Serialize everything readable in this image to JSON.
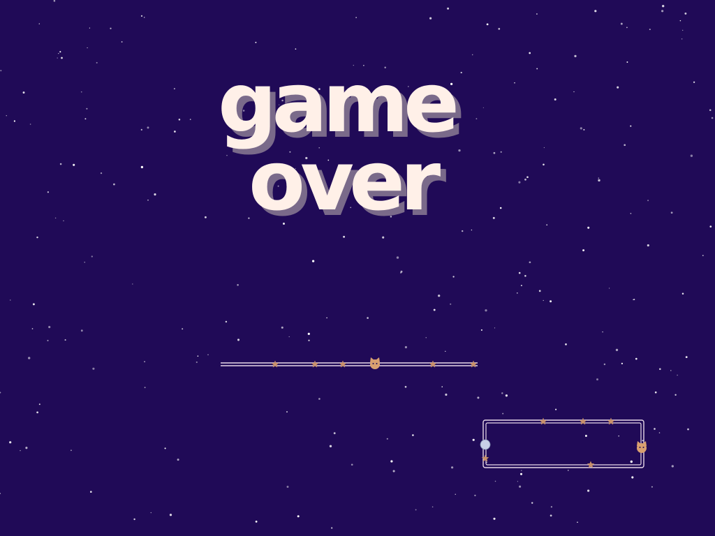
{
  "title": {
    "line1": "game",
    "line2": "over"
  },
  "colors": {
    "background": "#200a57",
    "title_fill": "#fff0e8",
    "title_shadow": "#7a6a8a",
    "track_line": "#e8d8e8",
    "star_ornament": "#c8906a",
    "cat_ornament": "#d8a070",
    "moon": "#c8d0e8",
    "star_dot": "#ffffff"
  },
  "icons": {
    "ornament_star": "star-icon",
    "ornament_cat": "cat-face-icon",
    "ornament_moon": "moon-icon"
  },
  "progress": {
    "fraction": 0.6
  }
}
